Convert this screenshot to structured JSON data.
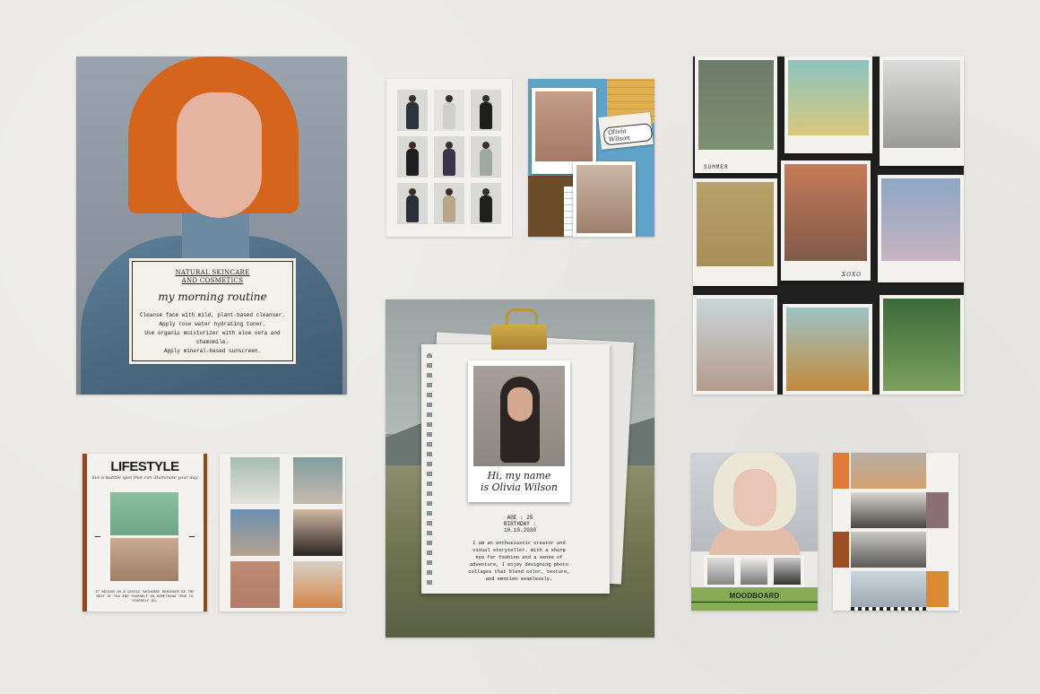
{
  "skincare_note": {
    "title_line1": "NATURAL SKINCARE",
    "title_line2": "AND COSMETICS",
    "script_title": "my morning routine",
    "steps": [
      "Cleanse face with mild, plant-based cleanser.",
      "Apply rose water hydrating toner.",
      "Use organic moisturizer with aloe vera and chamomile.",
      "Apply mineral-based sunscreen."
    ]
  },
  "collage": {
    "name_tag": "Olivia Wilson"
  },
  "polaroid_wall": {
    "captions": [
      "SUMMER",
      "XOXO"
    ]
  },
  "profile": {
    "greeting_line1": "Hi, my name",
    "greeting_line2": "is Olivia Wilson",
    "age": "AGE : 25",
    "birthday_label": "BIRTHDAY :",
    "birthday": "10.10.2030",
    "bio": "I am an enthusiastic creator and visual storyteller. With a sharp eye for fashion and a sense of adventure, I enjoy designing photo collages that blend color, texture, and emotion seamlessly."
  },
  "lifestyle": {
    "title": "LIFESTYLE",
    "subtitle": "live a bubble spot that can illuminate your day",
    "footer": "IT BEGINS AS A GENTLE SKINCARE REMINDER BE THE REST OF YOU AND YOURSELF AS SOMETHING TRUE TO YOURSELF DO."
  },
  "moodboard": {
    "label": "MOODBOARD"
  },
  "colors": {
    "background": "#e9e8e4",
    "hair_orange": "#d5641c",
    "moodboard_green": "#86ab57",
    "lifestyle_brown": "#8a4a24",
    "clip_gold": "#d2aa4d"
  },
  "icons": [
    "binder-clip-icon"
  ]
}
